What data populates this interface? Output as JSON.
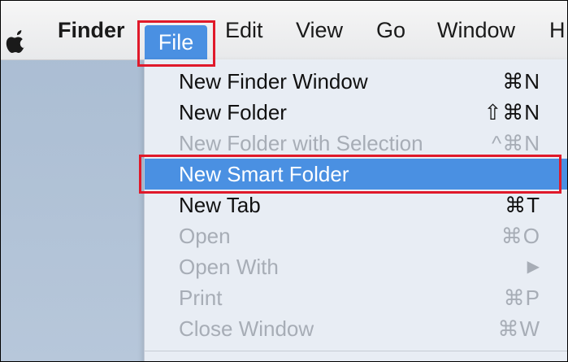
{
  "menubar": {
    "apple_icon": "apple-logo-icon",
    "items": [
      "Finder",
      "File",
      "Edit",
      "View",
      "Go",
      "Window",
      "H"
    ]
  },
  "file_menu": {
    "items": [
      {
        "label": "New Finder Window",
        "shortcut": "⌘N",
        "enabled": true
      },
      {
        "label": "New Folder",
        "shortcut": "⇧⌘N",
        "enabled": true
      },
      {
        "label": "New Folder with Selection",
        "shortcut": "^⌘N",
        "enabled": false
      },
      {
        "label": "New Smart Folder",
        "shortcut": "",
        "enabled": true,
        "highlighted": true
      },
      {
        "label": "New Tab",
        "shortcut": "⌘T",
        "enabled": true
      },
      {
        "label": "Open",
        "shortcut": "⌘O",
        "enabled": false
      },
      {
        "label": "Open With",
        "shortcut": "▶",
        "enabled": false
      },
      {
        "label": "Print",
        "shortcut": "⌘P",
        "enabled": false
      },
      {
        "label": "Close Window",
        "shortcut": "⌘W",
        "enabled": false
      }
    ]
  },
  "colors": {
    "selection": "#4a90e2",
    "annotation_red": "#e0192a",
    "disabled_text": "#a7adb6"
  }
}
